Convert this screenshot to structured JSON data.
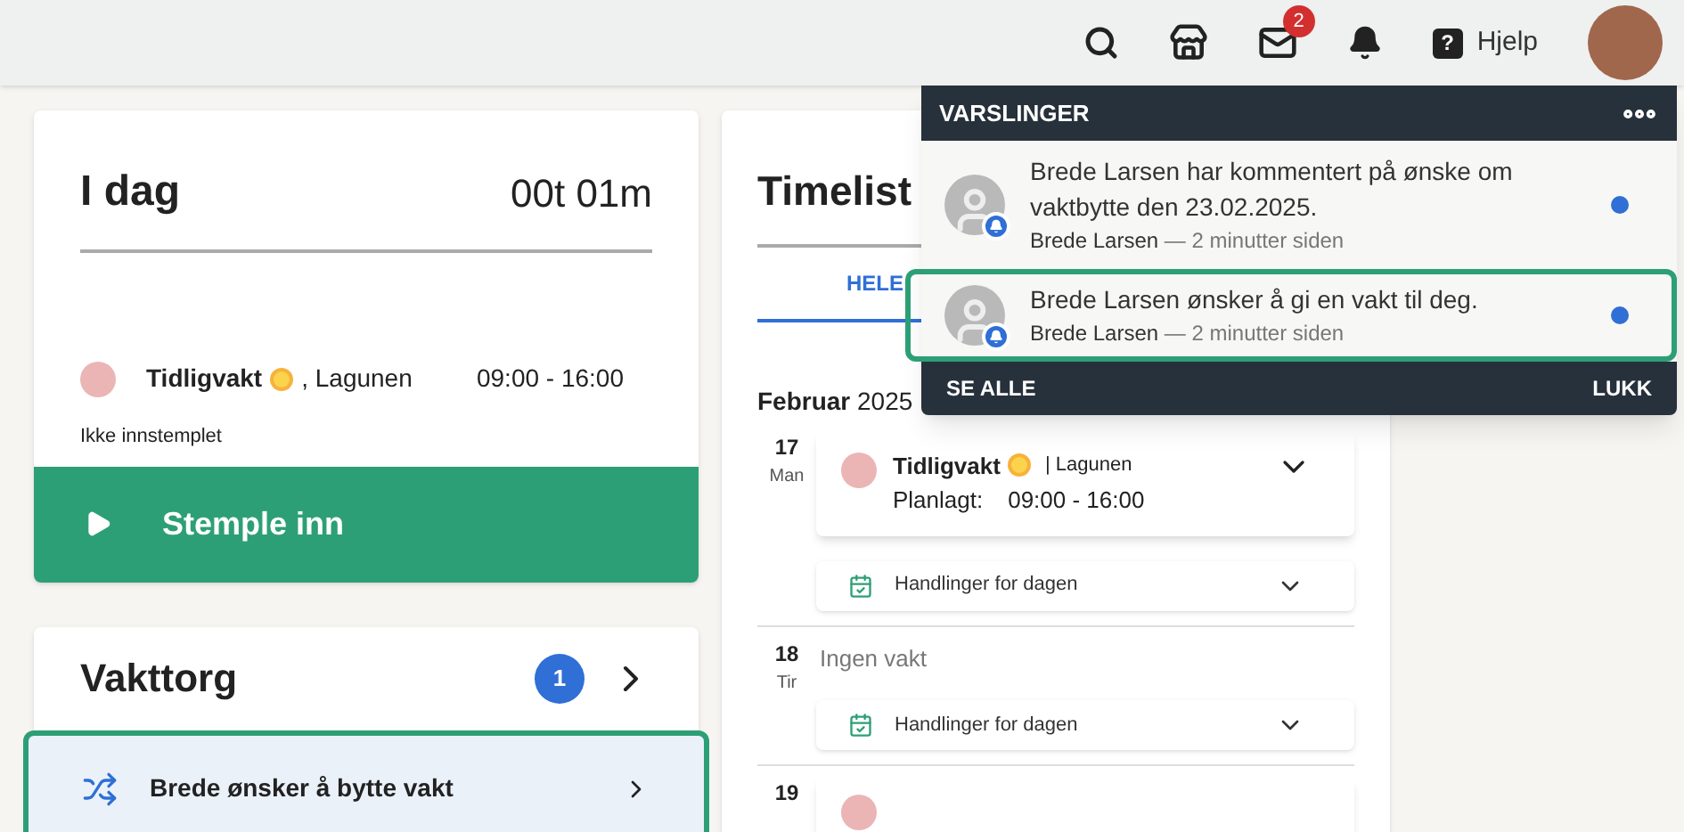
{
  "header": {
    "mail_badge": "2",
    "help_label": "Hjelp",
    "help_icon": "?"
  },
  "today": {
    "title": "I dag",
    "duration": "00t 01m",
    "shift": {
      "name": "Tidligvakt",
      "location": ", Lagunen",
      "time": "09:00 - 16:00",
      "color": "#ebb5b5"
    },
    "status": "Ikke innstemplet",
    "button": "Stemple inn"
  },
  "vakttorg": {
    "title": "Vakttorg",
    "count": "1",
    "item": {
      "text": "Brede ønsker å bytte vakt",
      "highlighted": true
    }
  },
  "timesheet": {
    "title": "Timelist",
    "tab": {
      "label": "HELE",
      "selected": true
    },
    "month": "**Februar** 2025",
    "days": [
      {
        "date": "17",
        "weekday": "Man",
        "kind": "shift",
        "shift": {
          "name": "Tidligvakt",
          "location": "| Lagunen",
          "planned_label": "Planlagt:",
          "time": "09:00 - 16:00",
          "color": "#ebb5b5"
        },
        "actions_label": "Handlinger for dagen"
      },
      {
        "date": "18",
        "weekday": "Tir",
        "kind": "empty",
        "empty_text": "Ingen vakt",
        "actions_label": "Handlinger for dagen"
      },
      {
        "date": "19",
        "kind": "clipped",
        "shift": {
          "color": "#ebb5b5"
        }
      }
    ]
  },
  "notifications": {
    "title": "VARSLINGER",
    "items": [
      {
        "text": "Brede Larsen har kommentert på ønske om vaktbytte den 23.02.2025.",
        "author": "Brede Larsen",
        "time": "— 2 minutter siden",
        "unread": true,
        "highlighted": false
      },
      {
        "text": "Brede Larsen ønsker å gi en vakt til deg.",
        "author": "Brede Larsen",
        "time": "— 2 minutter siden",
        "unread": true,
        "highlighted": true
      }
    ],
    "see_all": "SE ALLE",
    "close": "LUKK"
  }
}
